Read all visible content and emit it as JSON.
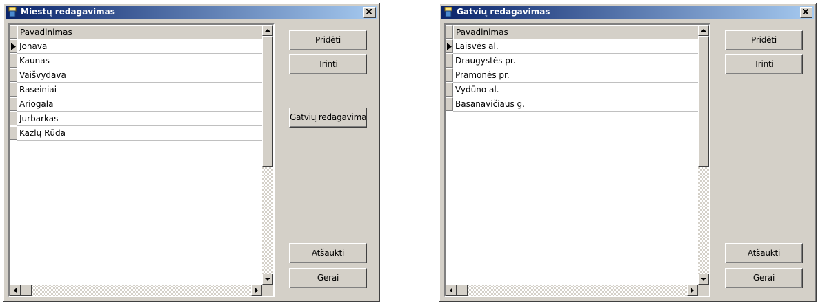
{
  "windows": [
    {
      "title": "Miestų redagavimas",
      "column_header": "Pavadinimas",
      "rows": [
        "Jonava",
        "Kaunas",
        "Vaišvydava",
        "Raseiniai",
        "Ariogala",
        "Jurbarkas",
        "Kazlų Rūda"
      ],
      "buttons": {
        "add": "Pridėti",
        "delete": "Trinti",
        "edit_streets": "Gatvių redagavimas",
        "cancel": "Atšaukti",
        "ok": "Gerai"
      }
    },
    {
      "title": "Gatvių redagavimas",
      "column_header": "Pavadinimas",
      "rows": [
        "Laisvės al.",
        "Draugystės pr.",
        "Pramonės pr.",
        "Vydūno al.",
        "Basanavičiaus g."
      ],
      "buttons": {
        "add": "Pridėti",
        "delete": "Trinti",
        "cancel": "Atšaukti",
        "ok": "Gerai"
      }
    }
  ],
  "icons": [
    "app-icon",
    "close-icon",
    "row-pointer-icon",
    "arrow-up-icon",
    "arrow-down-icon",
    "arrow-left-icon",
    "arrow-right-icon"
  ],
  "colors": {
    "titlebar_start": "#0a246a",
    "titlebar_end": "#a6caf0",
    "face": "#d4d0c8"
  }
}
